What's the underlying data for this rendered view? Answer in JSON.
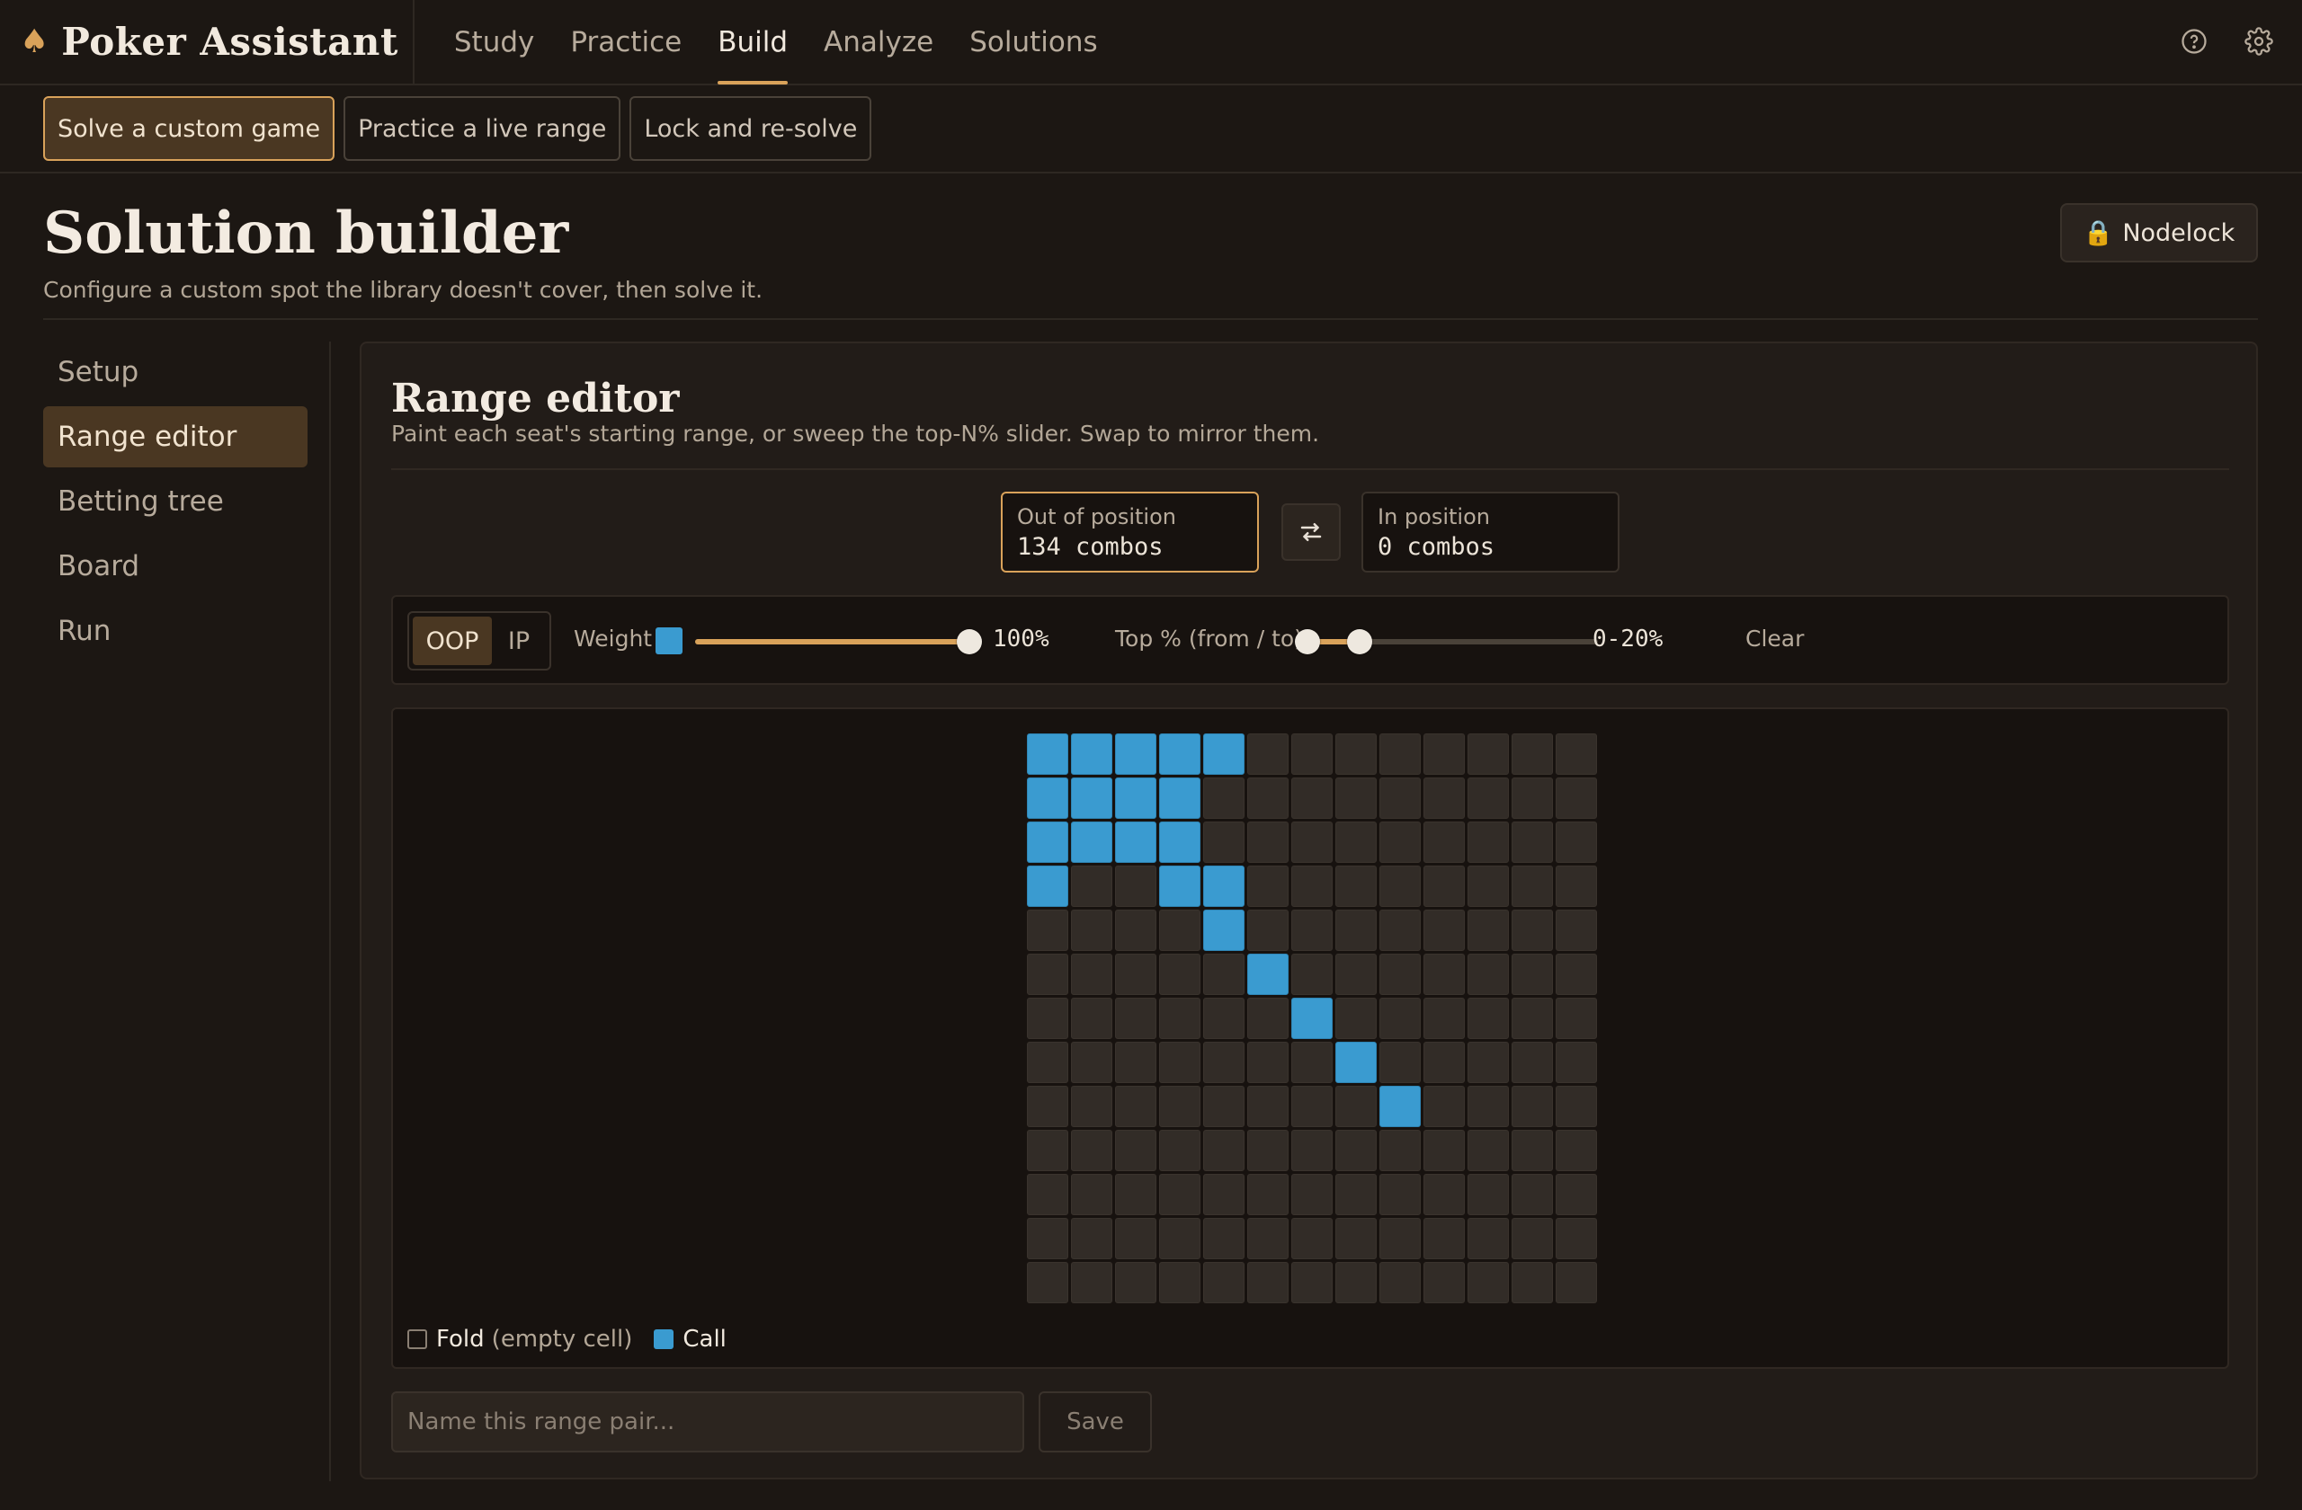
{
  "app": {
    "title": "Poker Assistant"
  },
  "nav": {
    "tabs": [
      {
        "label": "Study",
        "active": false
      },
      {
        "label": "Practice",
        "active": false
      },
      {
        "label": "Build",
        "active": true
      },
      {
        "label": "Analyze",
        "active": false
      },
      {
        "label": "Solutions",
        "active": false
      }
    ]
  },
  "subnav": {
    "items": [
      {
        "label": "Solve a custom game",
        "active": true
      },
      {
        "label": "Practice a live range",
        "active": false
      },
      {
        "label": "Lock and re-solve",
        "active": false
      }
    ]
  },
  "header": {
    "title": "Solution builder",
    "subtitle": "Configure a custom spot the library doesn't cover, then solve it.",
    "nodelock_label": "Nodelock"
  },
  "sidebar": {
    "items": [
      {
        "label": "Setup",
        "active": false
      },
      {
        "label": "Range editor",
        "active": true
      },
      {
        "label": "Betting tree",
        "active": false
      },
      {
        "label": "Board",
        "active": false
      },
      {
        "label": "Run",
        "active": false
      }
    ]
  },
  "editor": {
    "title": "Range editor",
    "subtitle": "Paint each seat's starting range, or sweep the top-N% slider. Swap to mirror them.",
    "oop": {
      "label": "Out of position",
      "value": "134 combos"
    },
    "ip": {
      "label": "In position",
      "value": "0 combos"
    },
    "toolbar": {
      "seat_oop": "OOP",
      "seat_ip": "IP",
      "weight_label": "Weight",
      "weight_value": "100%",
      "weight_fraction": 1.0,
      "top_label": "Top % (from / to)",
      "top_value": "0-20%",
      "top_from_pct": 0,
      "top_to_pct": 20,
      "clear_label": "Clear"
    },
    "legend": {
      "fold_label": "Fold",
      "fold_note": "(empty cell)",
      "call_label": "Call"
    },
    "name_placeholder": "Name this range pair...",
    "save_label": "Save"
  },
  "range_grid": {
    "size": 13,
    "call_cells": [
      [
        0,
        0
      ],
      [
        0,
        1
      ],
      [
        0,
        2
      ],
      [
        0,
        3
      ],
      [
        0,
        4
      ],
      [
        1,
        0
      ],
      [
        1,
        1
      ],
      [
        1,
        2
      ],
      [
        1,
        3
      ],
      [
        2,
        0
      ],
      [
        2,
        1
      ],
      [
        2,
        2
      ],
      [
        2,
        3
      ],
      [
        3,
        0
      ],
      [
        3,
        3
      ],
      [
        3,
        4
      ],
      [
        4,
        4
      ],
      [
        5,
        5
      ],
      [
        6,
        6
      ],
      [
        7,
        7
      ],
      [
        8,
        8
      ]
    ]
  },
  "colors": {
    "accent": "#d9a25a",
    "call": "#3a9bd0",
    "background": "#1c1713"
  }
}
